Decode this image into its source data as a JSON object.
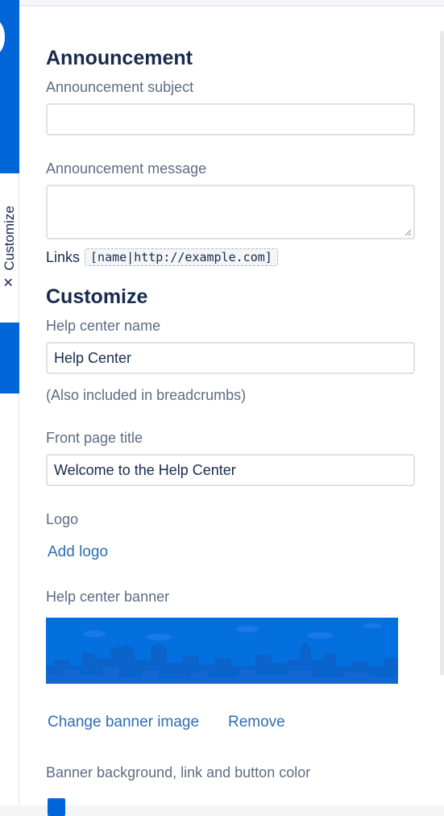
{
  "announcement": {
    "heading": "Announcement",
    "subject_label": "Announcement subject",
    "subject_value": "",
    "message_label": "Announcement message",
    "message_value": "",
    "links_label": "Links",
    "links_example": "[name|http://example.com]"
  },
  "sidebar": {
    "customize_tab_label": "Customize"
  },
  "customize": {
    "heading": "Customize",
    "help_center_name_label": "Help center name",
    "help_center_name_value": "Help Center",
    "help_center_name_hint": "(Also included in breadcrumbs)",
    "front_page_title_label": "Front page title",
    "front_page_title_value": "Welcome to the Help Center",
    "logo_label": "Logo",
    "add_logo_link": "Add logo",
    "banner_label": "Help center banner",
    "change_banner_link": "Change banner image",
    "remove_link": "Remove",
    "color_label": "Banner background, link and button color"
  },
  "colors": {
    "brand_blue": "#0065d8",
    "link_blue": "#2f6db5"
  }
}
